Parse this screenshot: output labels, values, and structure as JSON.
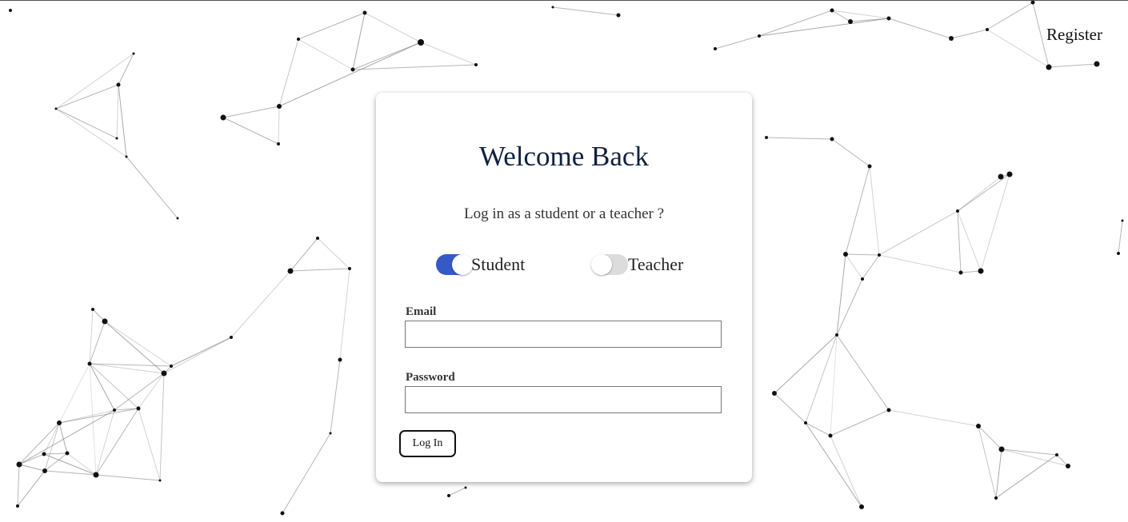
{
  "header": {
    "register_label": "Register"
  },
  "login": {
    "title": "Welcome Back",
    "subtitle": "Log in as a student or a teacher ?",
    "roles": [
      {
        "label": "Student",
        "selected": true
      },
      {
        "label": "Teacher",
        "selected": false
      }
    ],
    "email_label": "Email",
    "email_value": "",
    "password_label": "Password",
    "password_value": "",
    "submit_label": "Log In"
  },
  "colors": {
    "accent": "#3559c7",
    "title": "#0f2045",
    "toggle_off": "#dcdcdc"
  }
}
